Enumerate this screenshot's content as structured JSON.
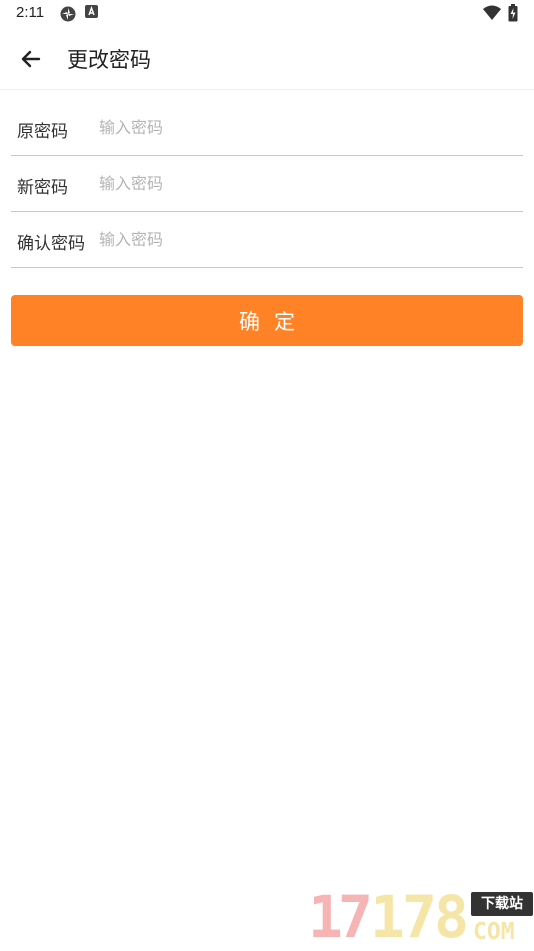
{
  "status_bar": {
    "time": "2:11"
  },
  "header": {
    "title": "更改密码"
  },
  "form": {
    "fields": [
      {
        "label": "原密码",
        "placeholder": "输入密码"
      },
      {
        "label": "新密码",
        "placeholder": "输入密码"
      },
      {
        "label": "确认密码",
        "placeholder": "输入密码"
      }
    ]
  },
  "confirm_button": {
    "label": "确定"
  },
  "watermark": {
    "digits": [
      "1",
      "7",
      "1",
      "7",
      "8"
    ],
    "tag": "下载站",
    "suffix": "COM"
  },
  "colors": {
    "accent": "#ff8227",
    "divider": "#c8c8c8",
    "placeholder": "#b4b4b4"
  }
}
